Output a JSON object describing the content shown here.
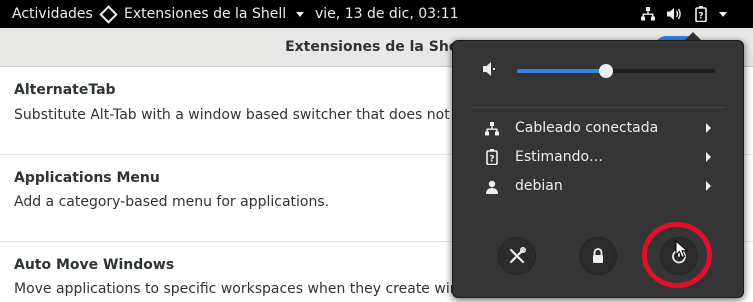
{
  "topbar": {
    "activities": "Actividades",
    "app_menu": "Extensiones de la Shell",
    "clock": "vie, 13 de dic, 03:11",
    "icons": [
      "network-wired-icon",
      "volume-icon",
      "battery-icon",
      "chevron-down-icon"
    ]
  },
  "window": {
    "title": "Extensiones de la Shell",
    "extensions": [
      {
        "name": "AlternateTab",
        "description": "Substitute Alt-Tab with a window based switcher that does not group by"
      },
      {
        "name": "Applications Menu",
        "description": "Add a category-based menu for applications."
      },
      {
        "name": "Auto Move Windows",
        "description": "Move applications to specific workspaces when they create windows."
      }
    ]
  },
  "popover": {
    "volume": {
      "icon": "speaker-muted-icon",
      "level": 0.45
    },
    "items": [
      {
        "icon": "network-wired-icon",
        "label": "Cableado conectada"
      },
      {
        "icon": "battery-icon",
        "label": "Estimando…"
      },
      {
        "icon": "user-icon",
        "label": "debian"
      }
    ],
    "buttons": [
      {
        "icon": "settings-icon",
        "name": "settings"
      },
      {
        "icon": "lock-icon",
        "name": "lock"
      },
      {
        "icon": "power-icon",
        "name": "power"
      }
    ]
  },
  "colors": {
    "topbar": "#000000",
    "popover": "#353535",
    "accent": "#3584e4",
    "highlight_ring": "#e0102b"
  }
}
